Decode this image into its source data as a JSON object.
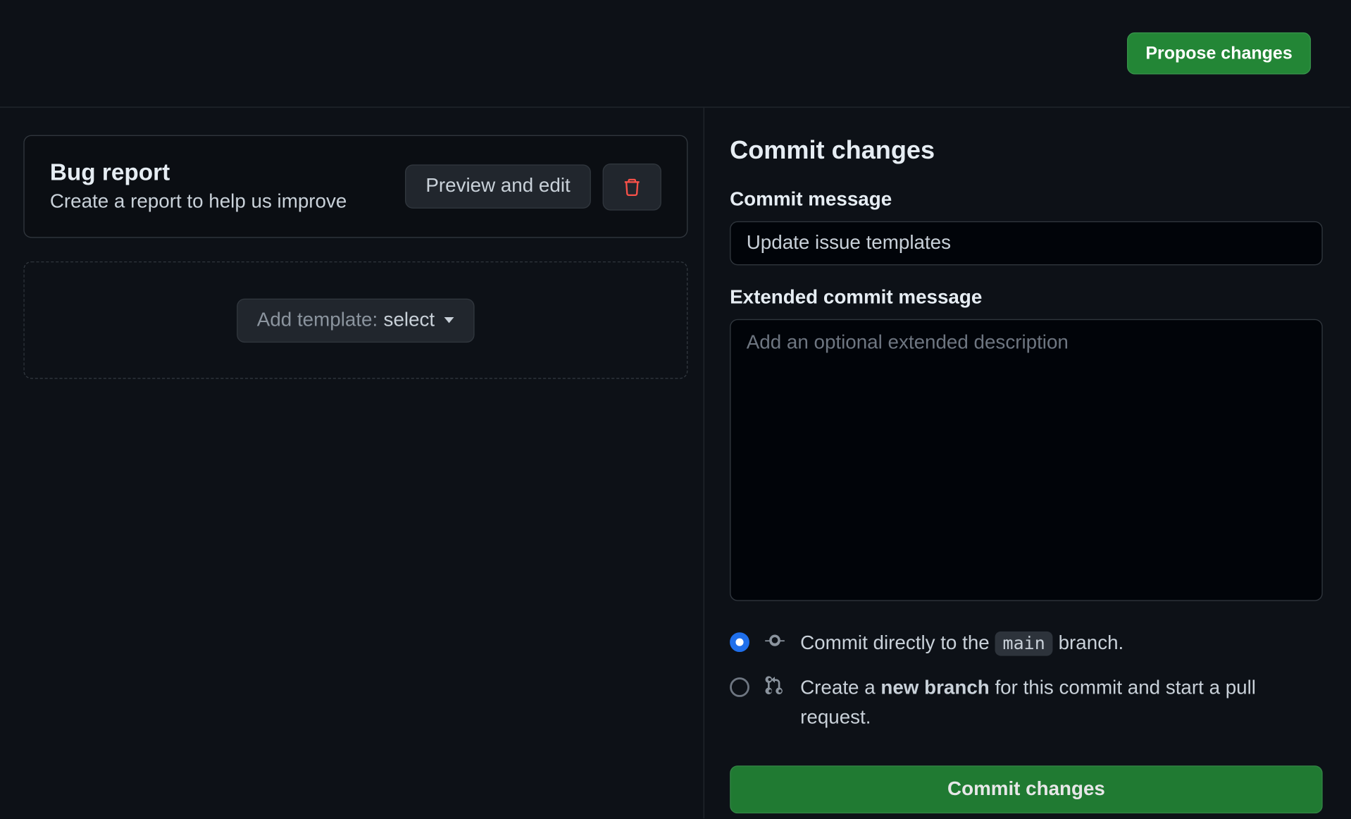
{
  "topbar": {
    "propose_button": "Propose changes"
  },
  "templates": {
    "items": [
      {
        "title": "Bug report",
        "description": "Create a report to help us improve",
        "preview_label": "Preview and edit"
      }
    ],
    "add_prefix": "Add template:",
    "add_value": "select"
  },
  "commit": {
    "heading": "Commit changes",
    "message_label": "Commit message",
    "message_value": "Update issue templates",
    "extended_label": "Extended commit message",
    "extended_placeholder": "Add an optional extended description",
    "radio_direct_pre": "Commit directly to the ",
    "radio_direct_branch": "main",
    "radio_direct_post": " branch.",
    "radio_branch_pre": "Create a ",
    "radio_branch_bold": "new branch",
    "radio_branch_post": " for this commit and start a pull request.",
    "commit_button": "Commit changes"
  }
}
